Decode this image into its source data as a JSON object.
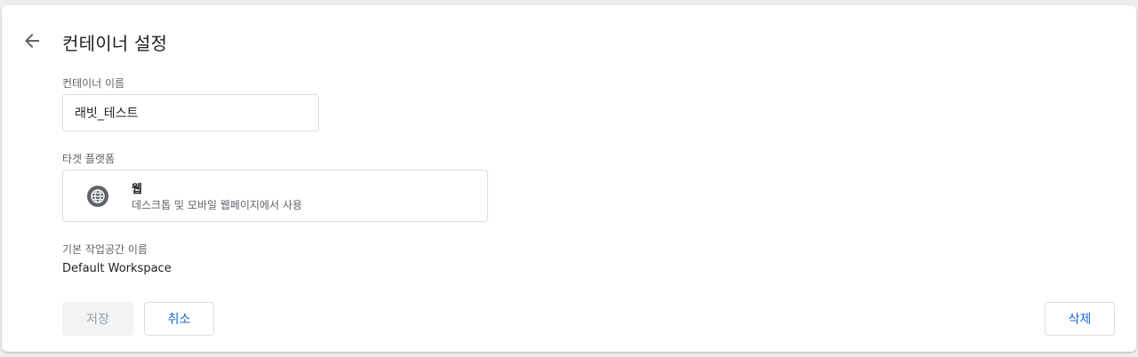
{
  "header": {
    "title": "컨테이너 설정",
    "back_icon": "arrow-back-icon"
  },
  "form": {
    "container_name": {
      "label": "컨테이너 이름",
      "value": "래빗_테스트"
    },
    "target_platform": {
      "label": "타겟 플랫폼",
      "icon": "globe-icon",
      "option_title": "웹",
      "option_description": "데스크톱 및 모바일 웹페이지에서 사용"
    },
    "default_workspace": {
      "label": "기본 작업공간 이름",
      "value": "Default Workspace"
    }
  },
  "actions": {
    "save_label": "저장",
    "cancel_label": "취소",
    "delete_label": "삭제"
  },
  "colors": {
    "accent": "#1967d2",
    "icon_gray": "#5f6368",
    "disabled_bg": "#f1f3f4",
    "disabled_text": "#9aa0a6"
  }
}
